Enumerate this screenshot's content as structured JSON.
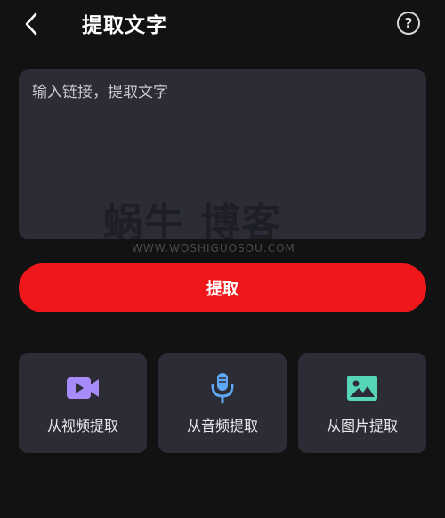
{
  "header": {
    "title": "提取文字",
    "help_symbol": "?"
  },
  "input": {
    "placeholder": "输入链接，提取文字",
    "value": ""
  },
  "watermark": {
    "main": "蜗牛 博客",
    "sub": "WWW.WOSHIGUOSOU.COM"
  },
  "extract_button": {
    "label": "提取"
  },
  "sources": [
    {
      "label": "从视频提取",
      "icon": "video-camera-icon",
      "color": "#a78bfa"
    },
    {
      "label": "从音频提取",
      "icon": "microphone-icon",
      "color": "#5fa8f5"
    },
    {
      "label": "从图片提取",
      "icon": "image-icon",
      "color": "#56d6b6"
    }
  ],
  "colors": {
    "background": "#121212",
    "card": "#2b2c36",
    "accent_red": "#f0171a"
  }
}
